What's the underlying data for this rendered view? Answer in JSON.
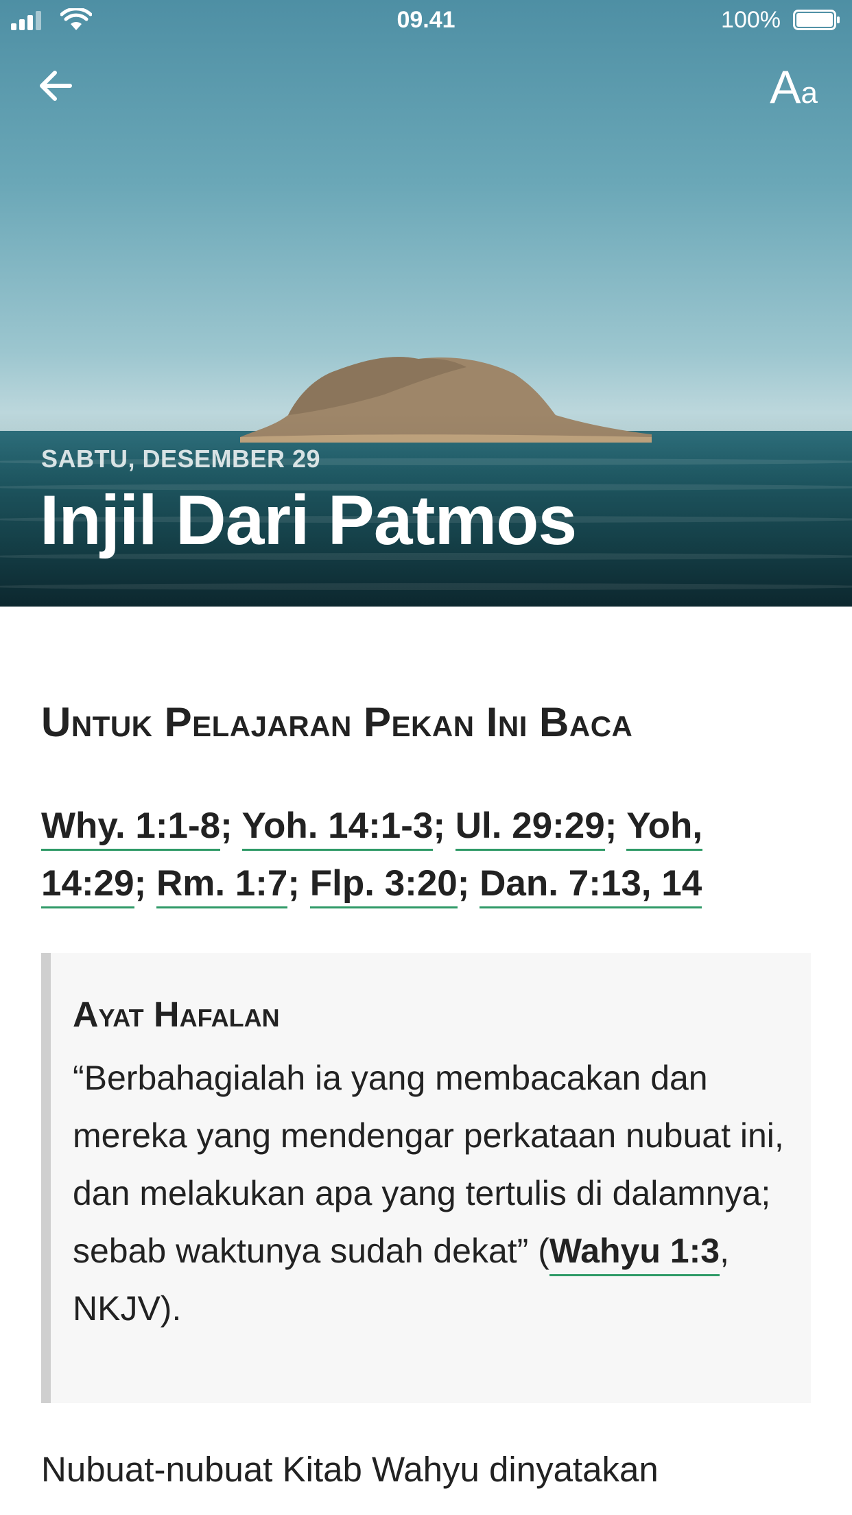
{
  "status_bar": {
    "time": "09.41",
    "battery": "100%"
  },
  "header": {
    "back_icon": "arrow-left-icon",
    "font_settings": {
      "big": "A",
      "small": "a"
    },
    "date": "SABTU, DESEMBER 29",
    "title": "Injil Dari Patmos"
  },
  "section": {
    "heading": "Untuk Pelajaran Pekan Ini Baca",
    "refs": [
      "Why. 1:1-8",
      "Yoh. 14:1-3",
      "Ul. 29:29",
      "Yoh, 14:29",
      "Rm. 1:7",
      "Flp. 3:20",
      "Dan. 7:13, 14"
    ],
    "separator": "; "
  },
  "memory_verse": {
    "heading": "Ayat Hafalan",
    "text": "“Berbahagialah ia yang membacakan dan mereka yang mendengar perkataan nubuat ini, dan melakukan apa yang tertulis di dalamnya; sebab waktunya sudah dekat” (",
    "ref": "Wahyu 1:3",
    "suffix": ", NKJV)."
  },
  "body": {
    "paragraph": "Nubuat-nubuat Kitab Wahyu dinyatakan"
  },
  "colors": {
    "link_underline": "#2f9a67",
    "quote_bar": "#cfcfcf",
    "quote_bg": "#f7f7f7"
  }
}
